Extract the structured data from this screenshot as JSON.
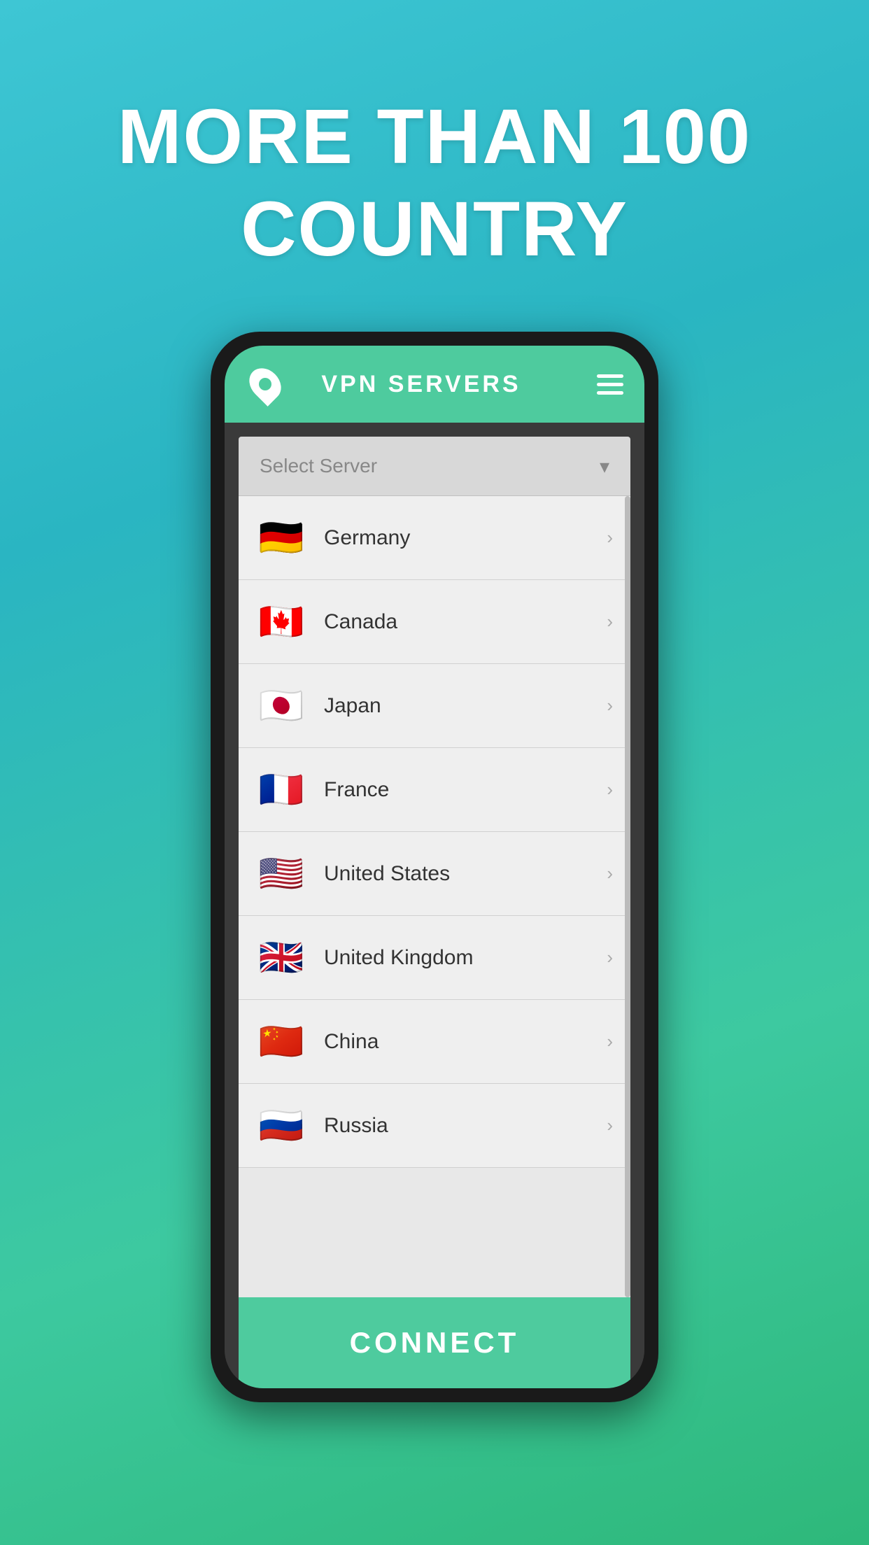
{
  "background": {
    "gradient_start": "#3ec6d4",
    "gradient_end": "#2eb87a"
  },
  "headline": {
    "line1": "MORE THAN 100",
    "line2": "COUNTRY"
  },
  "app_bar": {
    "title": "VPN SERVERS",
    "icon": "location-pin",
    "menu_icon": "hamburger"
  },
  "select_server": {
    "placeholder": "Select Server",
    "chevron": "▾"
  },
  "connect_button": {
    "label": "CONNECT"
  },
  "countries": [
    {
      "name": "Germany",
      "flag": "🇩🇪"
    },
    {
      "name": "Canada",
      "flag": "🇨🇦"
    },
    {
      "name": "Japan",
      "flag": "🇯🇵"
    },
    {
      "name": "France",
      "flag": "🇫🇷"
    },
    {
      "name": "United States",
      "flag": "🇺🇸"
    },
    {
      "name": "United Kingdom",
      "flag": "🇬🇧"
    },
    {
      "name": "China",
      "flag": "🇨🇳"
    },
    {
      "name": "Russia",
      "flag": "🇷🇺"
    }
  ]
}
